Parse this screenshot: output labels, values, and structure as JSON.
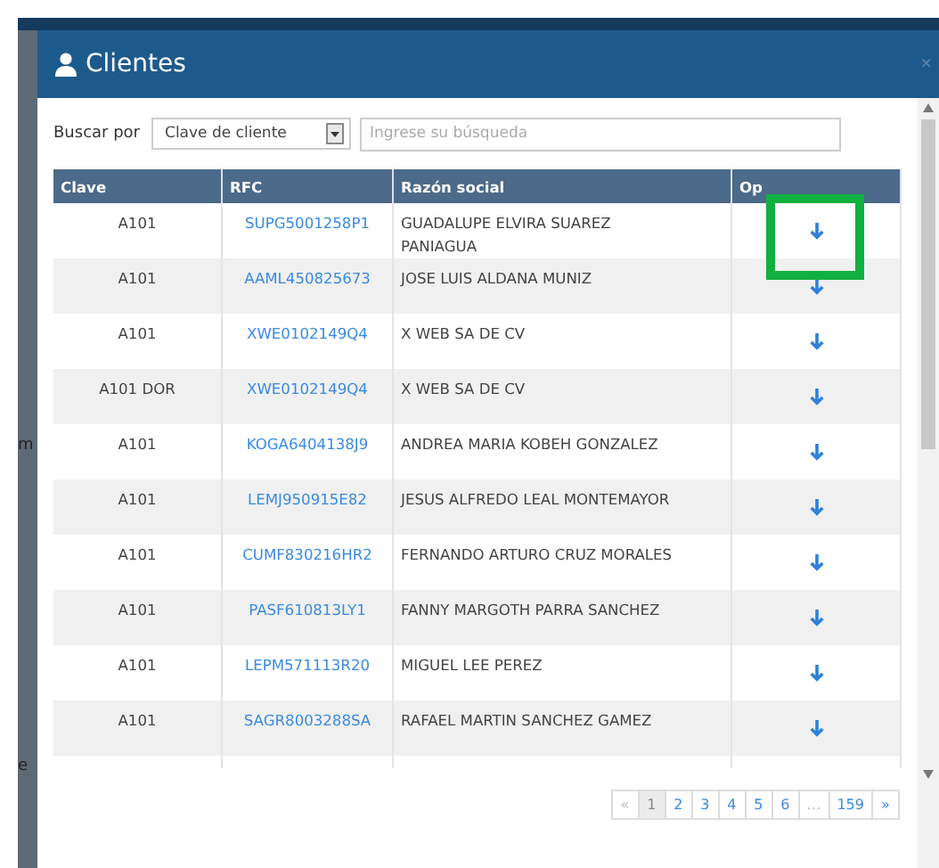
{
  "background": {
    "fragments": [
      "m",
      "e"
    ]
  },
  "dialog": {
    "title": "Clientes",
    "close": "×"
  },
  "search": {
    "label": "Buscar por",
    "field": "Clave de cliente",
    "placeholder": "Ingrese su búsqueda"
  },
  "table": {
    "columns": [
      "Clave",
      "RFC",
      "Razón social",
      "Op"
    ],
    "rows": [
      {
        "clave": "A101",
        "rfc": "SUPG5001258P1",
        "razon_social": "GUADALUPE ELVIRA SUAREZ PANIAGUA"
      },
      {
        "clave": "A101",
        "rfc": "AAML450825673",
        "razon_social": "JOSE LUIS ALDANA MUNIZ"
      },
      {
        "clave": "A101",
        "rfc": "XWE0102149Q4",
        "razon_social": "X WEB SA DE CV"
      },
      {
        "clave": "A101 DOR",
        "rfc": "XWE0102149Q4",
        "razon_social": "X WEB SA DE CV"
      },
      {
        "clave": "A101",
        "rfc": "KOGA6404138J9",
        "razon_social": "ANDREA MARIA KOBEH GONZALEZ"
      },
      {
        "clave": "A101",
        "rfc": "LEMJ950915E82",
        "razon_social": "JESUS ALFREDO LEAL MONTEMAYOR"
      },
      {
        "clave": "A101",
        "rfc": "CUMF830216HR2",
        "razon_social": "FERNANDO ARTURO CRUZ MORALES"
      },
      {
        "clave": "A101",
        "rfc": "PASF610813LY1",
        "razon_social": "FANNY MARGOTH PARRA SANCHEZ"
      },
      {
        "clave": "A101",
        "rfc": "LEPM571113R20",
        "razon_social": "MIGUEL LEE PEREZ"
      },
      {
        "clave": "A101",
        "rfc": "SAGR8003288SA",
        "razon_social": "RAFAEL MARTIN SANCHEZ GAMEZ"
      }
    ]
  },
  "pagination": [
    {
      "label": "«",
      "selected": false,
      "disabled": true
    },
    {
      "label": "1",
      "selected": true,
      "disabled": false
    },
    {
      "label": "2",
      "selected": false,
      "disabled": false
    },
    {
      "label": "3",
      "selected": false,
      "disabled": false
    },
    {
      "label": "4",
      "selected": false,
      "disabled": false
    },
    {
      "label": "5",
      "selected": false,
      "disabled": false
    },
    {
      "label": "6",
      "selected": false,
      "disabled": false
    },
    {
      "label": "…",
      "selected": false,
      "disabled": true
    },
    {
      "label": "159",
      "selected": false,
      "disabled": false
    },
    {
      "label": "»",
      "selected": false,
      "disabled": false
    }
  ]
}
